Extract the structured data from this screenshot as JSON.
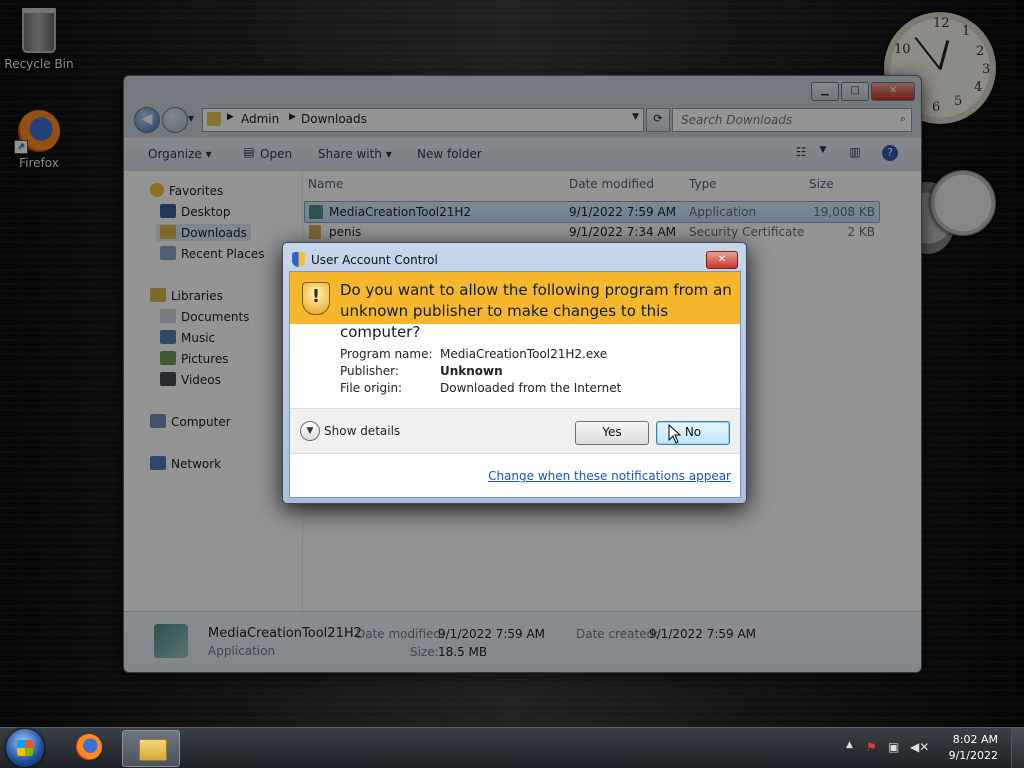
{
  "desktop": {
    "icons": [
      {
        "label": "Recycle Bin",
        "icon": "recycle-bin-icon"
      },
      {
        "label": "Firefox",
        "icon": "firefox-icon"
      }
    ],
    "clock_gadget": {
      "numbers": [
        "12",
        "1",
        "2",
        "3",
        "4",
        "5",
        "6",
        "10"
      ]
    }
  },
  "explorer": {
    "breadcrumb": [
      "Admin",
      "Downloads"
    ],
    "search_placeholder": "Search Downloads",
    "toolbar": {
      "organize": "Organize",
      "open": "Open",
      "share_with": "Share with",
      "new_folder": "New folder"
    },
    "nav": {
      "favorites": "Favorites",
      "favorite_items": [
        "Desktop",
        "Downloads",
        "Recent Places"
      ],
      "libraries": "Libraries",
      "library_items": [
        "Documents",
        "Music",
        "Pictures",
        "Videos"
      ],
      "computer": "Computer",
      "network": "Network"
    },
    "columns": {
      "name": "Name",
      "date": "Date modified",
      "type": "Type",
      "size": "Size"
    },
    "files": [
      {
        "name": "MediaCreationTool21H2",
        "date": "9/1/2022 7:59 AM",
        "type": "Application",
        "size": "19,008 KB"
      },
      {
        "name": "penis",
        "date": "9/1/2022 7:34 AM",
        "type": "Security Certificate",
        "size": "2 KB"
      }
    ],
    "details": {
      "name": "MediaCreationTool21H2",
      "kind": "Application",
      "date_modified_label": "Date modified:",
      "date_modified": "9/1/2022 7:59 AM",
      "size_label": "Size:",
      "size": "18.5 MB",
      "date_created_label": "Date created:",
      "date_created": "9/1/2022 7:59 AM"
    }
  },
  "uac": {
    "title": "User Account Control",
    "question": "Do you want to allow the following program from an unknown publisher to make changes to this computer?",
    "program_name_label": "Program name:",
    "program_name": "MediaCreationTool21H2.exe",
    "publisher_label": "Publisher:",
    "publisher": "Unknown",
    "file_origin_label": "File origin:",
    "file_origin": "Downloaded from the Internet",
    "show_details": "Show details",
    "yes": "Yes",
    "no": "No",
    "link": "Change when these notifications appear",
    "banner_color": "#f7b72c"
  },
  "taskbar": {
    "time": "8:02 AM",
    "date": "9/1/2022"
  }
}
